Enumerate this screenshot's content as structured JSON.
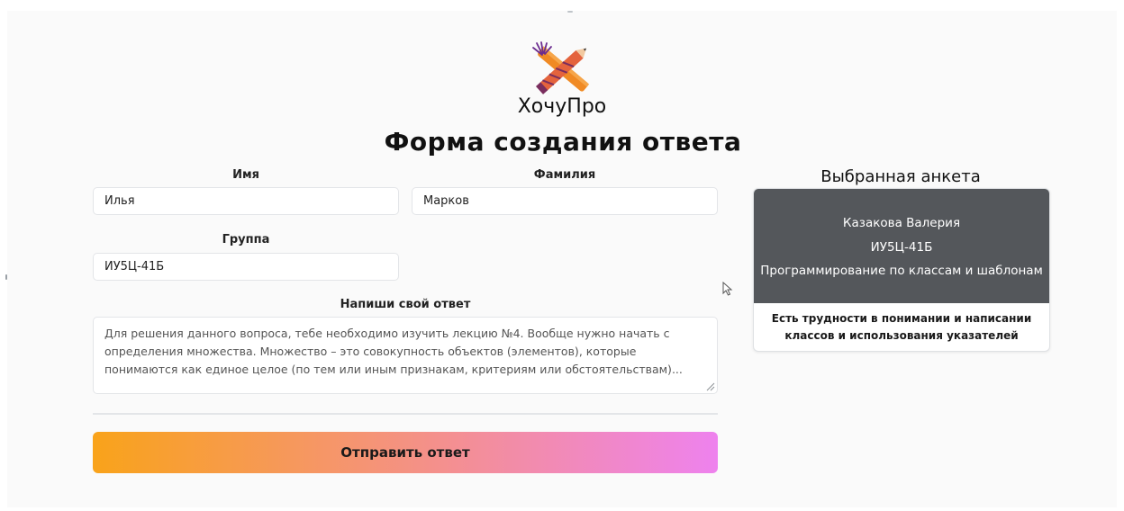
{
  "brand": {
    "name": "ХочуПро"
  },
  "page": {
    "title": "Форма создания ответа"
  },
  "form": {
    "first_name_label": "Имя",
    "first_name_value": "Илья",
    "last_name_label": "Фамилия",
    "last_name_value": "Марков",
    "group_label": "Группа",
    "group_value": "ИУ5Ц-41Б",
    "answer_label": "Напиши свой ответ",
    "answer_value": "Для решения данного вопроса, тебе необходимо изучить лекцию №4. Вообще нужно начать с определения множества. Множество – это совокупность объектов (элементов), которые понимаются как единое целое (по тем или иным признакам, критериям или обстоятельствам)...",
    "submit_label": "Отправить ответ"
  },
  "selected": {
    "title": "Выбранная анкета",
    "name": "Казакова Валерия",
    "group": "ИУ5Ц-41Б",
    "subject": "Программирование по классам и шаблонам",
    "problem": "Есть трудности в понимании и написании классов и использования указателей"
  },
  "colors": {
    "submit_gradient_start": "#f9a31a",
    "submit_gradient_end": "#ee82ee",
    "card_header_bg": "#54575b"
  },
  "icons": {
    "logo": "crossed-pencils-logo",
    "resize": "resize-grip-icon",
    "cursor": "mouse-pointer-icon"
  }
}
